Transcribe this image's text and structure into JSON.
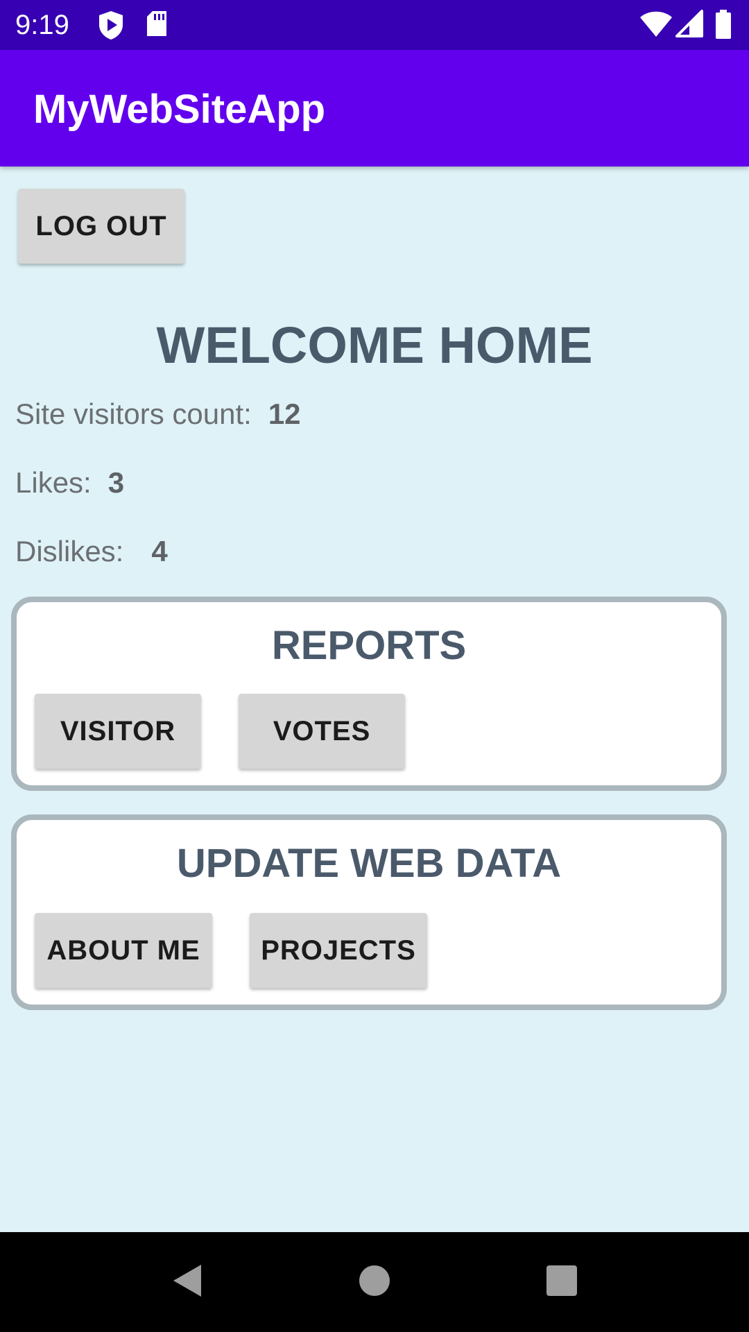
{
  "status_bar": {
    "time": "9:19",
    "icons": [
      "play-protect-icon",
      "sd-card-icon",
      "wifi-icon",
      "cell-signal-icon",
      "battery-icon"
    ]
  },
  "app_bar": {
    "title": "MyWebSiteApp",
    "color": "#6200ee"
  },
  "logout_label": "LOG OUT",
  "welcome_title": "WELCOME HOME",
  "stats": {
    "visitors_label": "Site visitors count:",
    "visitors_value": "12",
    "likes_label": "Likes:",
    "likes_value": "3",
    "dislikes_label": "Dislikes:",
    "dislikes_value": "4"
  },
  "reports": {
    "title": "REPORTS",
    "visitor_label": "VISITOR",
    "votes_label": "VOTES"
  },
  "update": {
    "title": "UPDATE WEB DATA",
    "about_label": "ABOUT ME",
    "projects_label": "PROJECTS"
  },
  "nav": {
    "icons": [
      "back-icon",
      "home-icon",
      "recents-icon"
    ]
  },
  "colors": {
    "status_bar": "#3700b3",
    "background": "#dff2f7",
    "heading": "#4a5a6b",
    "button": "#d6d6d6"
  }
}
